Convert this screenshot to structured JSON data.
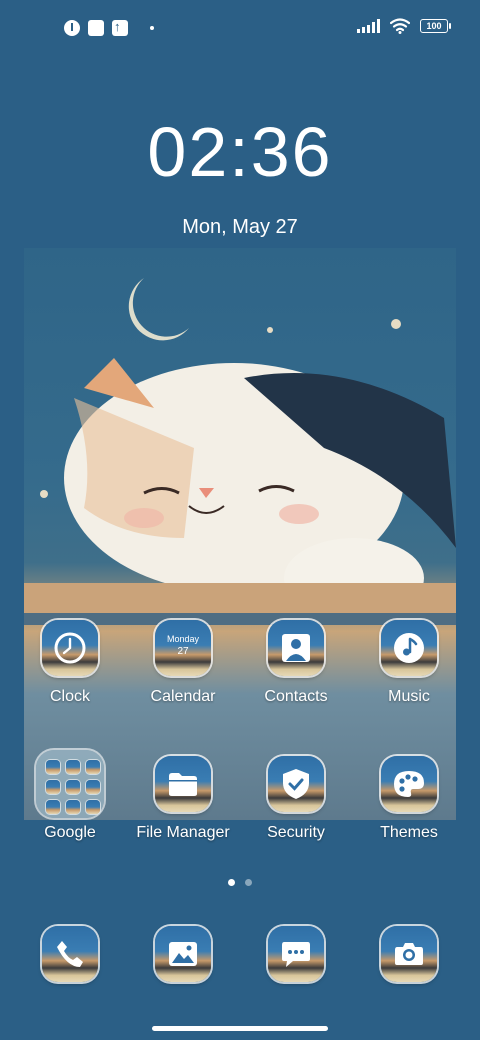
{
  "status_bar": {
    "battery_level": "100",
    "icons": [
      "notification-app-icon",
      "notification-square-icon",
      "upload-icon",
      "more-dot-icon",
      "signal-icon",
      "wifi-icon",
      "battery-icon"
    ]
  },
  "lock": {
    "time": "02:36",
    "date": "Mon, May 27"
  },
  "apps": {
    "clock": "Clock",
    "calendar": "Calendar",
    "calendar_day": "Monday",
    "calendar_date": "27",
    "contacts": "Contacts",
    "music": "Music",
    "google": "Google",
    "file_manager": "File Manager",
    "security": "Security",
    "themes": "Themes"
  },
  "pages": {
    "count": 2,
    "active": 1
  },
  "colors": {
    "background": "#2b5f86",
    "text": "#ffffff"
  }
}
